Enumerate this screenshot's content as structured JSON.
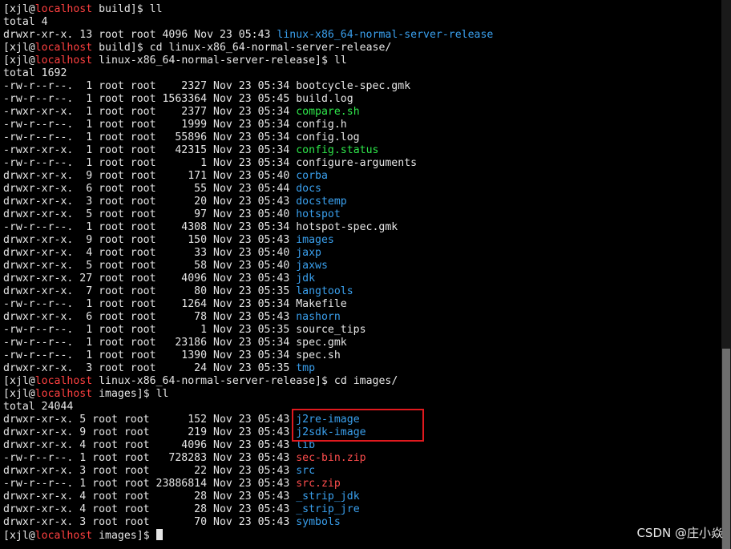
{
  "colors": {
    "background": "#000000",
    "text": "#e6e6e6",
    "hostname": "#ff4040",
    "directory": "#3aa0ee",
    "executable": "#2ee64a",
    "archive": "#ff4d4d",
    "highlight_box": "#e0191e"
  },
  "lines": [
    [
      [
        "[xjl@",
        "p"
      ],
      [
        "localhost",
        "h"
      ],
      [
        " build]$ ll",
        "p"
      ]
    ],
    [
      [
        "total 4",
        "p"
      ]
    ],
    [
      [
        "drwxr-xr-x. 13 root root 4096 Nov 23 05:43 ",
        "p"
      ],
      [
        "linux-x86_64-normal-server-release",
        "d"
      ]
    ],
    [
      [
        "[xjl@",
        "p"
      ],
      [
        "localhost",
        "h"
      ],
      [
        " build]$ cd linux-x86_64-normal-server-release/",
        "p"
      ]
    ],
    [
      [
        "[xjl@",
        "p"
      ],
      [
        "localhost",
        "h"
      ],
      [
        " linux-x86_64-normal-server-release]$ ll",
        "p"
      ]
    ],
    [
      [
        "total 1692",
        "p"
      ]
    ],
    [
      [
        "-rw-r--r--.  1 root root    2327 Nov 23 05:34 bootcycle-spec.gmk",
        "p"
      ]
    ],
    [
      [
        "-rw-r--r--.  1 root root 1563364 Nov 23 05:45 build.log",
        "p"
      ]
    ],
    [
      [
        "-rwxr-xr-x.  1 root root    2377 Nov 23 05:34 ",
        "p"
      ],
      [
        "compare.sh",
        "e"
      ]
    ],
    [
      [
        "-rw-r--r--.  1 root root    1999 Nov 23 05:34 config.h",
        "p"
      ]
    ],
    [
      [
        "-rw-r--r--.  1 root root   55896 Nov 23 05:34 config.log",
        "p"
      ]
    ],
    [
      [
        "-rwxr-xr-x.  1 root root   42315 Nov 23 05:34 ",
        "p"
      ],
      [
        "config.status",
        "e"
      ]
    ],
    [
      [
        "-rw-r--r--.  1 root root       1 Nov 23 05:34 configure-arguments",
        "p"
      ]
    ],
    [
      [
        "drwxr-xr-x.  9 root root     171 Nov 23 05:40 ",
        "p"
      ],
      [
        "corba",
        "d"
      ]
    ],
    [
      [
        "drwxr-xr-x.  6 root root      55 Nov 23 05:44 ",
        "p"
      ],
      [
        "docs",
        "d"
      ]
    ],
    [
      [
        "drwxr-xr-x.  3 root root      20 Nov 23 05:43 ",
        "p"
      ],
      [
        "docstemp",
        "d"
      ]
    ],
    [
      [
        "drwxr-xr-x.  5 root root      97 Nov 23 05:40 ",
        "p"
      ],
      [
        "hotspot",
        "d"
      ]
    ],
    [
      [
        "-rw-r--r--.  1 root root    4308 Nov 23 05:34 hotspot-spec.gmk",
        "p"
      ]
    ],
    [
      [
        "drwxr-xr-x.  9 root root     150 Nov 23 05:43 ",
        "p"
      ],
      [
        "images",
        "d"
      ]
    ],
    [
      [
        "drwxr-xr-x.  4 root root      33 Nov 23 05:40 ",
        "p"
      ],
      [
        "jaxp",
        "d"
      ]
    ],
    [
      [
        "drwxr-xr-x.  5 root root      58 Nov 23 05:40 ",
        "p"
      ],
      [
        "jaxws",
        "d"
      ]
    ],
    [
      [
        "drwxr-xr-x. 27 root root    4096 Nov 23 05:43 ",
        "p"
      ],
      [
        "jdk",
        "d"
      ]
    ],
    [
      [
        "drwxr-xr-x.  7 root root      80 Nov 23 05:35 ",
        "p"
      ],
      [
        "langtools",
        "d"
      ]
    ],
    [
      [
        "-rw-r--r--.  1 root root    1264 Nov 23 05:34 Makefile",
        "p"
      ]
    ],
    [
      [
        "drwxr-xr-x.  6 root root      78 Nov 23 05:43 ",
        "p"
      ],
      [
        "nashorn",
        "d"
      ]
    ],
    [
      [
        "-rw-r--r--.  1 root root       1 Nov 23 05:35 source_tips",
        "p"
      ]
    ],
    [
      [
        "-rw-r--r--.  1 root root   23186 Nov 23 05:34 spec.gmk",
        "p"
      ]
    ],
    [
      [
        "-rw-r--r--.  1 root root    1390 Nov 23 05:34 spec.sh",
        "p"
      ]
    ],
    [
      [
        "drwxr-xr-x.  3 root root      24 Nov 23 05:35 ",
        "p"
      ],
      [
        "tmp",
        "d"
      ]
    ],
    [
      [
        "[xjl@",
        "p"
      ],
      [
        "localhost",
        "h"
      ],
      [
        " linux-x86_64-normal-server-release]$ cd images/",
        "p"
      ]
    ],
    [
      [
        "[xjl@",
        "p"
      ],
      [
        "localhost",
        "h"
      ],
      [
        " images]$ ll",
        "p"
      ]
    ],
    [
      [
        "total 24044",
        "p"
      ]
    ],
    [
      [
        "drwxr-xr-x. 5 root root      152 Nov 23 05:43 ",
        "p"
      ],
      [
        "j2re-image",
        "d"
      ]
    ],
    [
      [
        "drwxr-xr-x. 9 root root      219 Nov 23 05:43 ",
        "p"
      ],
      [
        "j2sdk-image",
        "d"
      ]
    ],
    [
      [
        "drwxr-xr-x. 4 root root     4096 Nov 23 05:43 ",
        "p"
      ],
      [
        "lib",
        "d"
      ]
    ],
    [
      [
        "-rw-r--r--. 1 root root   728283 Nov 23 05:43 ",
        "p"
      ],
      [
        "sec-bin.zip",
        "a"
      ]
    ],
    [
      [
        "drwxr-xr-x. 3 root root       22 Nov 23 05:43 ",
        "p"
      ],
      [
        "src",
        "d"
      ]
    ],
    [
      [
        "-rw-r--r--. 1 root root 23886814 Nov 23 05:43 ",
        "p"
      ],
      [
        "src.zip",
        "a"
      ]
    ],
    [
      [
        "drwxr-xr-x. 4 root root       28 Nov 23 05:43 ",
        "p"
      ],
      [
        "_strip_jdk",
        "d"
      ]
    ],
    [
      [
        "drwxr-xr-x. 4 root root       28 Nov 23 05:43 ",
        "p"
      ],
      [
        "_strip_jre",
        "d"
      ]
    ],
    [
      [
        "drwxr-xr-x. 3 root root       70 Nov 23 05:43 ",
        "p"
      ],
      [
        "symbols",
        "d"
      ]
    ],
    [
      [
        "[xjl@",
        "p"
      ],
      [
        "localhost",
        "h"
      ],
      [
        " images]$ ",
        "p"
      ]
    ]
  ],
  "watermark": "CSDN @庄小焱"
}
